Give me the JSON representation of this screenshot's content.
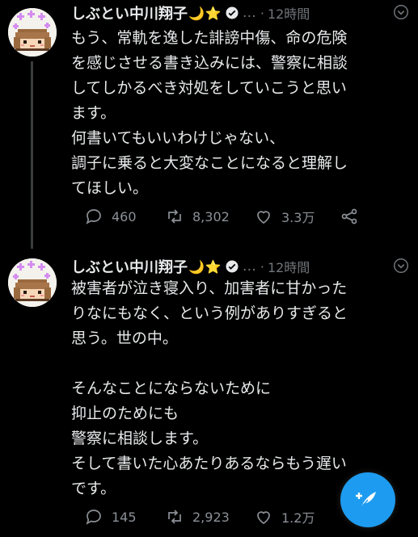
{
  "tweets": [
    {
      "author_name": "しぶとい中川翔子",
      "emoji_1": "🌙",
      "emoji_2": "⭐",
      "dots": "…",
      "separator": "·",
      "time": "12時間",
      "text": "もう、常軌を逸した誹謗中傷、命の危険\nを感じさせる書き込みには、警察に相談\nしてしかるべき対処をしていこうと思い\nます。\n何書いてもいいわけじゃない、\n調子に乗ると大変なことになると理解し\nてほしい。",
      "replies": "460",
      "retweets": "8,302",
      "likes": "3.3万"
    },
    {
      "author_name": "しぶとい中川翔子",
      "emoji_1": "🌙",
      "emoji_2": "⭐",
      "dots": "…",
      "separator": "·",
      "time": "12時間",
      "text": "被害者が泣き寝入り、加害者に甘かった\nりなにもなく、という例がありすぎると\n思う。世の中。\n\nそんなことにならないために\n抑止のためにも\n警察に相談します。\nそして書いた心あたりあるならもう遅い\nです。",
      "replies": "145",
      "retweets": "2,923",
      "likes": "1.2万"
    }
  ],
  "icons": {
    "verified": "verified-badge-icon",
    "more": "chevron-down-icon",
    "reply": "reply-icon",
    "retweet": "retweet-icon",
    "like": "heart-icon",
    "share": "share-icon",
    "compose": "compose-feather-icon"
  },
  "colors": {
    "background": "#000000",
    "text": "#e7e9ea",
    "muted": "#71767b",
    "accent": "#1d9bf0"
  }
}
